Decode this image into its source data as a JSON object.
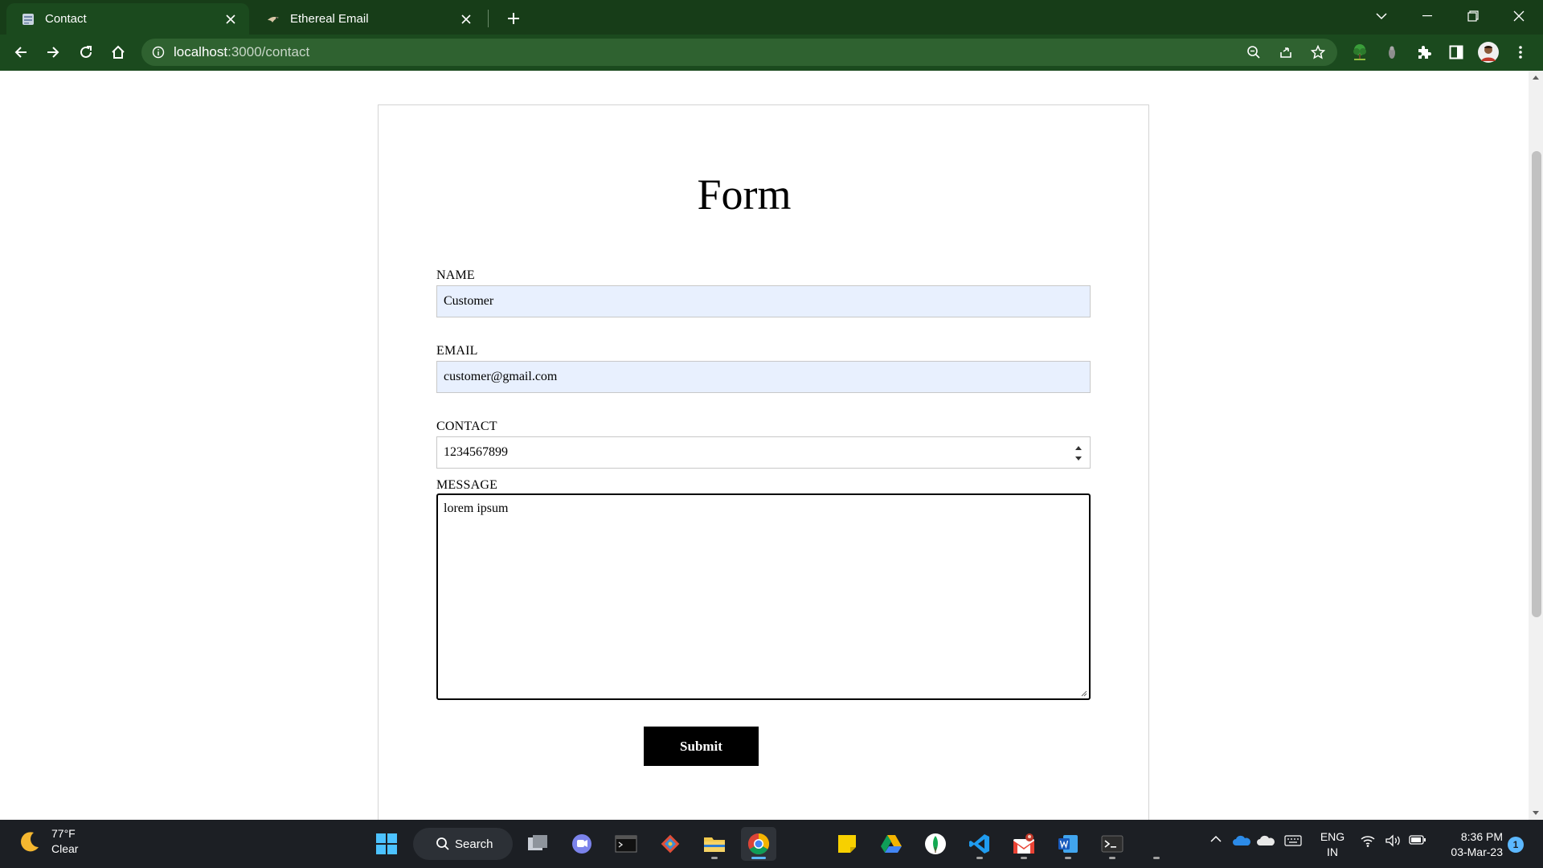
{
  "browser": {
    "tabs": [
      {
        "title": "Contact",
        "active": true
      },
      {
        "title": "Ethereal Email",
        "active": false
      }
    ],
    "url_host": "localhost",
    "url_path": ":3000/contact"
  },
  "form": {
    "title": "Form",
    "fields": {
      "name": {
        "label": "NAME",
        "value": "Customer"
      },
      "email": {
        "label": "EMAIL",
        "value": "customer@gmail.com"
      },
      "contact": {
        "label": "CONTACT",
        "value": "1234567899"
      },
      "message": {
        "label": "MESSAGE",
        "value": "lorem ipsum"
      }
    },
    "submit_label": "Submit"
  },
  "taskbar": {
    "weather": {
      "temp": "77°F",
      "condition": "Clear"
    },
    "search_label": "Search",
    "language": {
      "line1": "ENG",
      "line2": "IN"
    },
    "clock": {
      "time": "8:36 PM",
      "date": "03-Mar-23"
    },
    "notification_count": "1"
  },
  "colors": {
    "chrome_bg": "#1b4a1e",
    "tabstrip_bg": "#173d18",
    "autofill_bg": "#e8f0fe",
    "submit_bg": "#000000",
    "taskbar_bg": "#1c1f24",
    "accent": "#5cb8ff"
  }
}
